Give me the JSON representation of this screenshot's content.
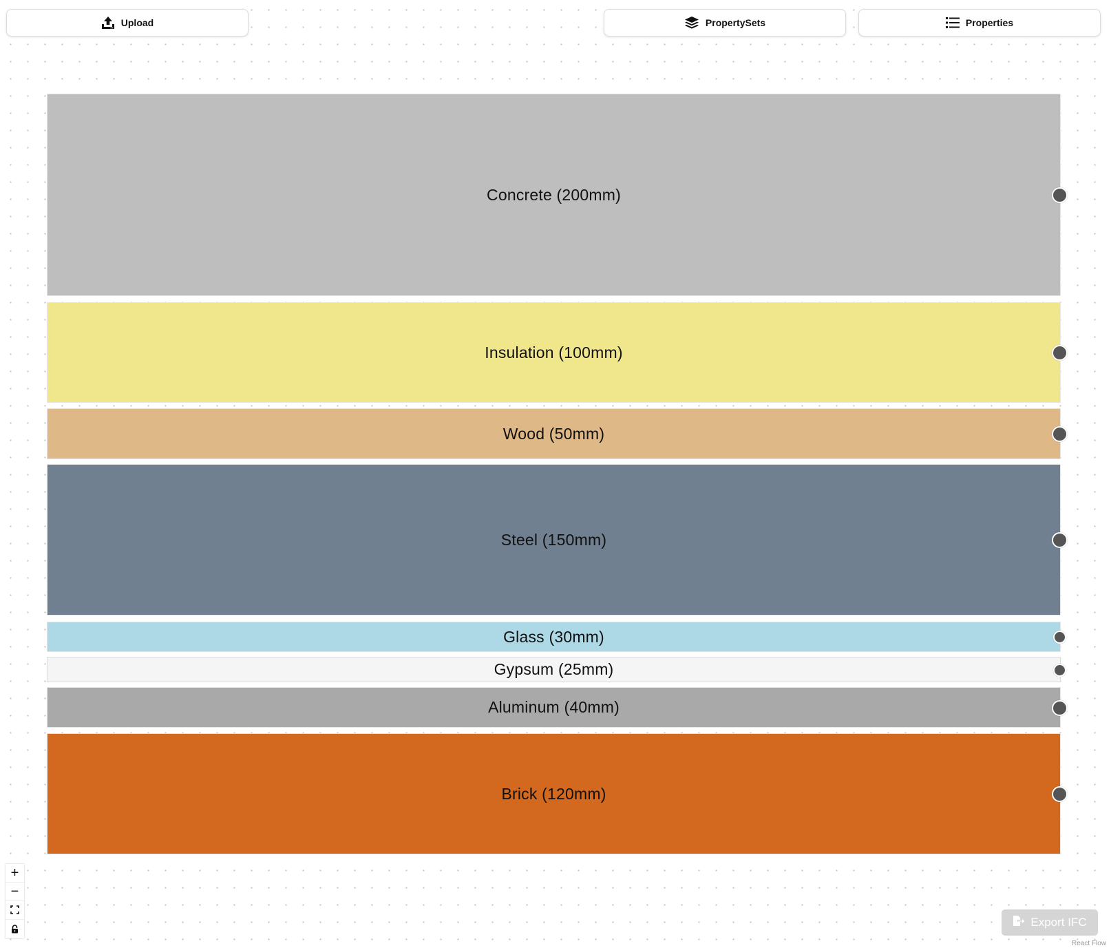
{
  "toolbar": {
    "upload_label": "Upload",
    "property_sets_label": "PropertySets",
    "properties_label": "Properties",
    "upload_icon": "upload-icon",
    "property_sets_icon": "layers-icon",
    "properties_icon": "list-icon"
  },
  "layers": [
    {
      "label": "Concrete (200mm)",
      "material": "Concrete",
      "thickness_mm": 200,
      "color": "#bebebe"
    },
    {
      "label": "Insulation (100mm)",
      "material": "Insulation",
      "thickness_mm": 100,
      "color": "#f0e68c"
    },
    {
      "label": "Wood (50mm)",
      "material": "Wood",
      "thickness_mm": 50,
      "color": "#deb887"
    },
    {
      "label": "Steel (150mm)",
      "material": "Steel",
      "thickness_mm": 150,
      "color": "#708090"
    },
    {
      "label": "Glass (30mm)",
      "material": "Glass",
      "thickness_mm": 30,
      "color": "#add8e6"
    },
    {
      "label": "Gypsum (25mm)",
      "material": "Gypsum",
      "thickness_mm": 25,
      "color": "#f5f5f5"
    },
    {
      "label": "Aluminum (40mm)",
      "material": "Aluminum",
      "thickness_mm": 40,
      "color": "#a9a9a9"
    },
    {
      "label": "Brick (120mm)",
      "material": "Brick",
      "thickness_mm": 120,
      "color": "#d2691e"
    }
  ],
  "controls": {
    "zoom_in": "+",
    "zoom_out": "−",
    "fit_view_icon": "fit-view-icon",
    "lock_icon": "lock-icon"
  },
  "export": {
    "label": "Export IFC",
    "icon": "file-export-icon"
  },
  "attribution": "React Flow"
}
